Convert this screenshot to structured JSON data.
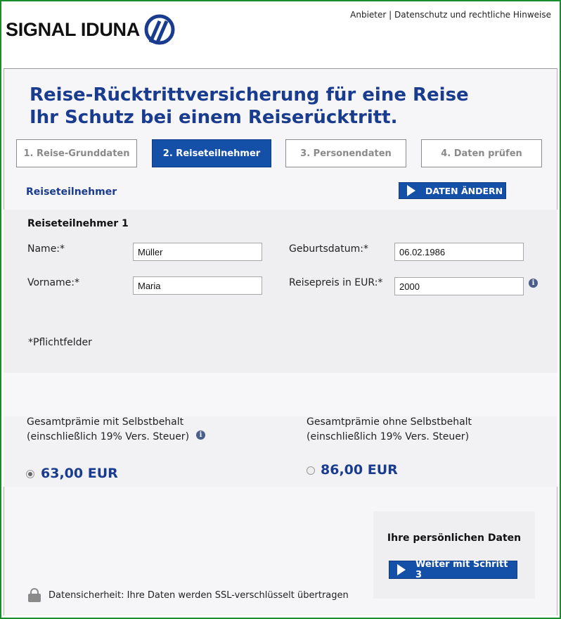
{
  "header": {
    "brand": "SIGNAL IDUNA",
    "links": [
      "Anbieter",
      "Datenschutz und rechtliche Hinweise"
    ],
    "separator": "|"
  },
  "title": {
    "line1": "Reise-Rücktrittversicherung für eine Reise",
    "line2": "Ihr Schutz bei einem Reiserücktritt."
  },
  "steps": [
    {
      "label": "1. Reise-Grunddaten",
      "active": false
    },
    {
      "label": "2. Reiseteilnehmer",
      "active": true
    },
    {
      "label": "3. Personendaten",
      "active": false
    },
    {
      "label": "4. Daten prüfen",
      "active": false
    }
  ],
  "section": {
    "heading": "Reiseteilnehmer",
    "change_button": "DATEN ÄNDERN"
  },
  "participant": {
    "heading": "Reiseteilnehmer 1",
    "name_label": "Name:*",
    "name_value": "Müller",
    "firstname_label": "Vorname:*",
    "firstname_value": "Maria",
    "birthdate_label": "Geburtsdatum:*",
    "birthdate_value": "06.02.1986",
    "price_label": "Reisepreis in EUR:*",
    "price_value": "2000",
    "required_note": "*Pflichtfelder"
  },
  "premium": {
    "with_deductible_line1": "Gesamtprämie mit Selbstbehalt",
    "with_deductible_line2": "(einschließlich 19% Vers. Steuer)",
    "with_deductible_price": "63,00 EUR",
    "with_deductible_selected": true,
    "without_deductible_line1": "Gesamtprämie ohne Selbstbehalt",
    "without_deductible_line2": "(einschließlich 19% Vers. Steuer)",
    "without_deductible_price": "86,00 EUR",
    "without_deductible_selected": false
  },
  "sidebar": {
    "title": "Ihre persönlichen Daten",
    "next_button": "Weiter mit Schritt 3"
  },
  "footer": {
    "security_text": "Datensicherheit: Ihre Daten werden SSL-verschlüsselt übertragen"
  },
  "colors": {
    "accent_blue": "#1550a8",
    "title_blue": "#1a3c8f",
    "frame_green": "#1a8c2b"
  },
  "icons": [
    "logo-mark-icon",
    "info-icon",
    "play-triangle-icon",
    "lock-icon"
  ]
}
